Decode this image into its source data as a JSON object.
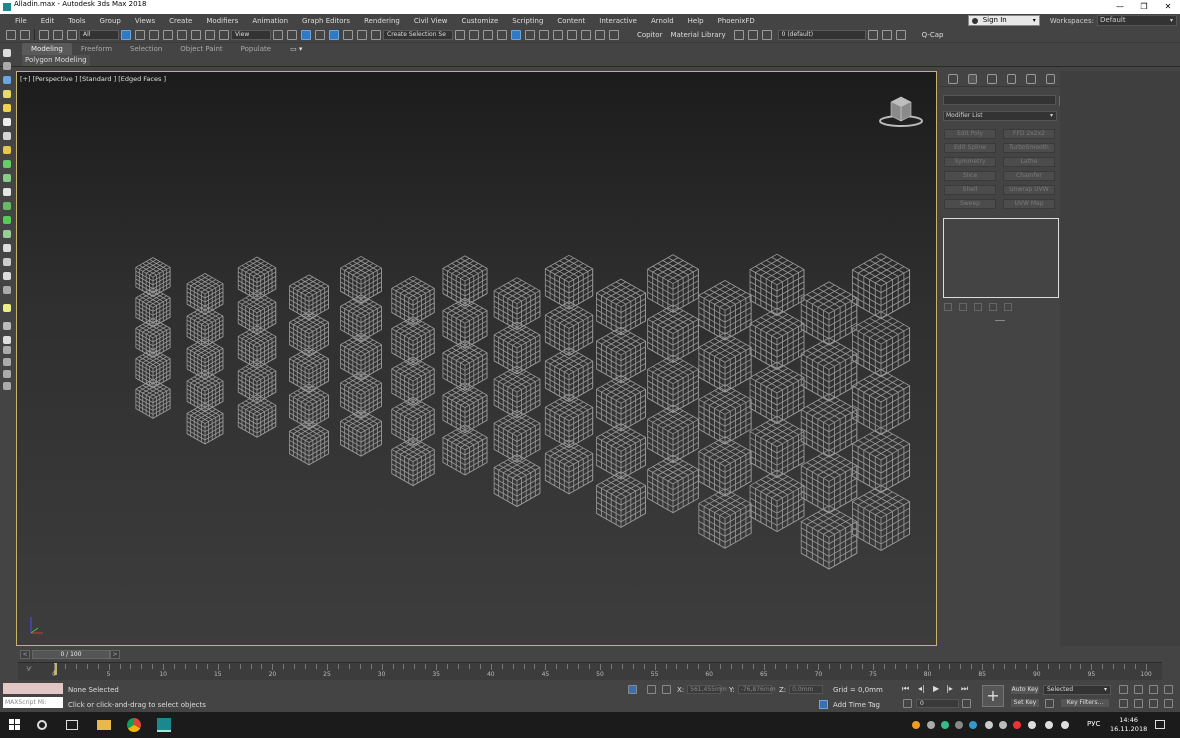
{
  "window": {
    "title": "Alladin.max - Autodesk 3ds Max 2018",
    "minimize": "—",
    "restore": "❐",
    "close": "✕"
  },
  "menu": [
    "File",
    "Edit",
    "Tools",
    "Group",
    "Views",
    "Create",
    "Modifiers",
    "Animation",
    "Graph Editors",
    "Rendering",
    "Civil View",
    "Customize",
    "Scripting",
    "Content",
    "Interactive",
    "Arnold",
    "Help",
    "PhoenixFD"
  ],
  "account": {
    "signin": "Sign In",
    "workspaces_label": "Workspaces:",
    "workspace": "Default"
  },
  "toolbar": {
    "filter": "All",
    "refcoord": "View",
    "selection_set": "Create Selection Se",
    "copitor": "Copitor",
    "material_library": "Material Library",
    "layer": "0 (default)",
    "qcap": "Q-Cap"
  },
  "ribbon": {
    "tabs": [
      "Modeling",
      "Freeform",
      "Selection",
      "Object Paint",
      "Populate"
    ],
    "active": "Modeling",
    "panel": "Polygon Modeling"
  },
  "viewport": {
    "label": "[+] [Perspective ] [Standard ] [Edged Faces ]"
  },
  "command_panel": {
    "modifier_list": "Modifier List",
    "buttons": [
      [
        "Edit Poly",
        "FFD 2x2x2"
      ],
      [
        "Edit Spline",
        "TurboSmooth"
      ],
      [
        "Symmetry",
        "Lathe"
      ],
      [
        "Slice",
        "Chamfer"
      ],
      [
        "Shell",
        "Unwrap UVW"
      ],
      [
        "Sweep",
        "UVW Map"
      ]
    ],
    "object_color": "#d02f8e"
  },
  "time": {
    "current": "0 / 100",
    "prev": "<",
    "next": ">",
    "filter": "⅟⁄",
    "ticks": [
      "0",
      "5",
      "10",
      "15",
      "20",
      "25",
      "30",
      "35",
      "40",
      "45",
      "50",
      "55",
      "60",
      "65",
      "70",
      "75",
      "80",
      "85",
      "90",
      "95",
      "100"
    ]
  },
  "status": {
    "maxscript": "MAXScript Mi:",
    "line1": "None Selected",
    "line2": "Click or click-and-drag to select objects",
    "x_label": "X:",
    "x_value": "561,455mm",
    "y_label": "Y:",
    "y_value": "-76,876mm",
    "z_label": "Z:",
    "z_value": "0,0mm",
    "grid": "Grid = 0,0mm",
    "add_time_tag": "Add Time Tag",
    "frame": "0",
    "auto_key": "Auto Key",
    "set_key": "Set Key",
    "key_mode": "Selected",
    "key_filters": "Key Filters..."
  },
  "taskbar": {
    "lang": "РУС",
    "time": "14:46",
    "date": "16.11.2018"
  }
}
